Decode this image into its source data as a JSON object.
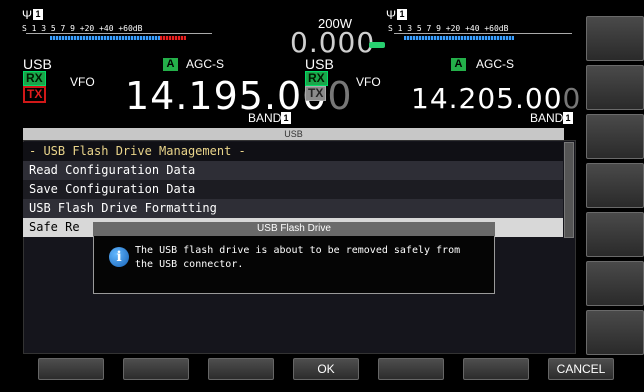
{
  "top": {
    "power": "200W",
    "left_meter": {
      "scale_text": "S  1   3   5   7   9   +20  +40 +60dB",
      "antenna_number": "1"
    },
    "right_meter": {
      "scale_text": "S  1   3   5   7   9   +20  +40 +60dB",
      "antenna_number": "1"
    },
    "offset_display": "0.000",
    "vfo_a": {
      "mode": "USB",
      "rx": "RX",
      "tx": "TX",
      "vfo_label": "VFO",
      "a_badge": "A",
      "agc": "AGC-S",
      "frequency_main": "14.195.00",
      "frequency_dim": "0",
      "band_label": "BAND",
      "band_number": "1"
    },
    "vfo_b": {
      "mode": "USB",
      "rx": "RX",
      "tx": "TX",
      "vfo_label": "VFO",
      "a_badge": "A",
      "agc": "AGC-S",
      "frequency_main": "14.205.00",
      "frequency_dim": "0",
      "band_label": "BAND",
      "band_number": "1"
    }
  },
  "menu": {
    "title": "USB",
    "items": [
      "- USB Flash Drive Management -",
      "Read Configuration Data",
      "Save Configuration Data",
      "USB Flash Drive Formatting",
      "Safe Re"
    ]
  },
  "dialog": {
    "title": "USB Flash Drive",
    "icon": "info-icon",
    "message_line1": "The USB flash drive is about to be removed safely from",
    "message_line2": "the USB connector."
  },
  "softkeys": {
    "bottom": [
      "",
      "",
      "",
      "OK",
      "",
      "",
      "CANCEL"
    ]
  },
  "colors": {
    "rx_green": "#1aa64a",
    "tx_red": "#d01818",
    "a_badge_green": "#24b04a",
    "selected_row": "#d8d8d8",
    "header_yellow": "#e9d48a",
    "meter_blue": "#3aa0ff",
    "meter_red": "#e82020",
    "offset_led_green": "#28d070"
  }
}
